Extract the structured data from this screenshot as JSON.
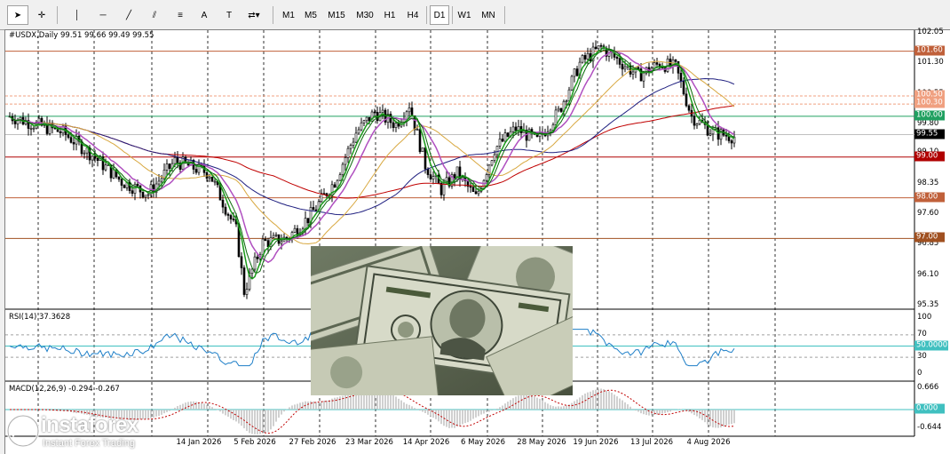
{
  "toolbar": {
    "tools": [
      {
        "name": "cursor-arrow-icon",
        "glyph": "➤"
      },
      {
        "name": "crosshair-icon",
        "glyph": "✛"
      },
      {
        "name": "vertical-line-icon",
        "glyph": "│"
      },
      {
        "name": "horizontal-line-icon",
        "glyph": "─"
      },
      {
        "name": "trendline-icon",
        "glyph": "╱"
      },
      {
        "name": "equidistant-channel-icon",
        "glyph": "⫽"
      },
      {
        "name": "fibonacci-icon",
        "glyph": "≡"
      },
      {
        "name": "text-label-icon",
        "glyph": "A"
      },
      {
        "name": "text-tool-icon",
        "glyph": "T"
      },
      {
        "name": "arrows-dropdown-icon",
        "glyph": "⇄▾"
      }
    ],
    "timeframes": [
      "M1",
      "M5",
      "M15",
      "M30",
      "H1",
      "H4",
      "D1",
      "W1",
      "MN"
    ],
    "active_timeframe": "D1"
  },
  "main_chart": {
    "title": "#USDX,Daily  99.51 99.66 99.49 99.55",
    "symbol": "#USDX",
    "timeframe": "Daily",
    "ohlc": {
      "open": 99.51,
      "high": 99.66,
      "low": 99.49,
      "close": 99.55
    },
    "price_axis_labels": [
      "102.05",
      "101.30",
      "100.55",
      "99.80",
      "99.10",
      "98.35",
      "97.60",
      "96.85",
      "96.10",
      "95.35"
    ],
    "current_price": "99.55",
    "level_tags": [
      {
        "label": "101.60",
        "color": "#c0603a"
      },
      {
        "label": "100.50",
        "color": "#f0a080"
      },
      {
        "label": "100.30",
        "color": "#f0a080"
      },
      {
        "label": "100.00",
        "color": "#20a060"
      },
      {
        "label": "99.00",
        "color": "#b00000"
      },
      {
        "label": "98.00",
        "color": "#c0603a"
      },
      {
        "label": "97.00",
        "color": "#a05020"
      }
    ]
  },
  "rsi_panel": {
    "title": "RSI(14) 37.3628",
    "axis_labels": [
      "100",
      "70",
      "50",
      "30",
      "0"
    ],
    "level_tag": "50.0000"
  },
  "macd_panel": {
    "title": "MACD(12,26,9) -0.294 -0.267",
    "axis_labels": [
      "0.666",
      "-0.644"
    ],
    "level_tag": "0.000"
  },
  "date_axis": [
    "14 Jan 2026",
    "5 Feb 2026",
    "27 Feb 2026",
    "23 Mar 2026",
    "14 Apr 2026",
    "6 May 2026",
    "28 May 2026",
    "19 Jun 2026",
    "13 Jul 2026",
    "4 Aug 2026"
  ],
  "watermark": {
    "brand": "instaforex",
    "tagline": "Instant Forex Trading"
  },
  "colors": {
    "bullish_candle": "#000000",
    "ma_green": "#1a9a1a",
    "ma_violet": "#b050c0",
    "ma_gold": "#d8a840",
    "ma_navy": "#202080",
    "ma_red": "#c00000",
    "rsi_line": "#1e7fc8",
    "macd_histogram": "#c0c0c0",
    "macd_signal": "#c00000"
  }
}
